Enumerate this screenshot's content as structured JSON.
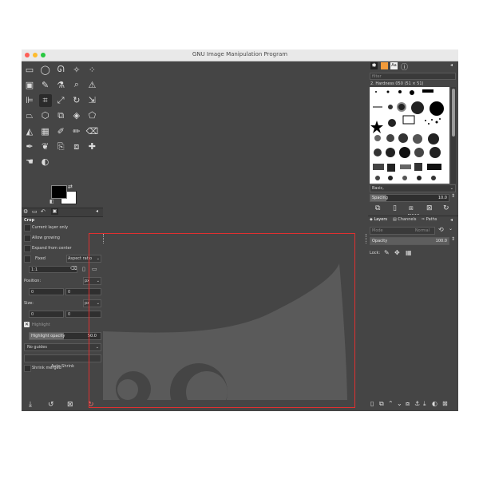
{
  "window": {
    "title": "GNU Image Manipulation Program",
    "colors": {
      "close": "#fe5f57",
      "minimize": "#febc2e",
      "zoom": "#28c840",
      "selection": "#e03030"
    }
  },
  "toolbox": {
    "tools": [
      {
        "name": "rect-select-icon",
        "glyph": "▭"
      },
      {
        "name": "ellipse-select-icon",
        "glyph": "◯"
      },
      {
        "name": "free-select-icon",
        "glyph": "ᘏ"
      },
      {
        "name": "fuzzy-select-icon",
        "glyph": "✧"
      },
      {
        "name": "select-by-color-icon",
        "glyph": "⁘"
      },
      {
        "name": "scissors-select-icon",
        "glyph": "✂"
      },
      {
        "name": "foreground-select-icon",
        "glyph": "▣"
      },
      {
        "name": "paths-icon",
        "glyph": "✎"
      },
      {
        "name": "color-picker-icon",
        "glyph": "⚗"
      },
      {
        "name": "zoom-icon",
        "glyph": "⌕"
      },
      {
        "name": "measure-icon",
        "glyph": "⚠"
      },
      {
        "name": "move-icon",
        "glyph": "✥"
      },
      {
        "name": "align-icon",
        "glyph": "⊫"
      },
      {
        "name": "crop-icon",
        "glyph": "⌗"
      },
      {
        "name": "unified-transform-icon",
        "glyph": "⤢"
      },
      {
        "name": "rotate-icon",
        "glyph": "↻"
      },
      {
        "name": "scale-icon",
        "glyph": "⇲"
      },
      {
        "name": "shear-icon",
        "glyph": "⧄"
      },
      {
        "name": "perspective-icon",
        "glyph": "⏢"
      },
      {
        "name": "3d-transform-icon",
        "glyph": "⬡"
      },
      {
        "name": "warp-transform-icon",
        "glyph": "⧉"
      },
      {
        "name": "handle-transform-icon",
        "glyph": "◈"
      },
      {
        "name": "cage-transform-icon",
        "glyph": "⬠"
      },
      {
        "name": "text-icon",
        "glyph": "A"
      },
      {
        "name": "bucket-fill-icon",
        "glyph": "◭"
      },
      {
        "name": "gradient-icon",
        "glyph": "▦"
      },
      {
        "name": "paintbrush-icon",
        "glyph": "✐"
      },
      {
        "name": "pencil-icon",
        "glyph": "✏"
      },
      {
        "name": "eraser-icon",
        "glyph": "⌫"
      },
      {
        "name": "airbrush-icon",
        "glyph": "✑"
      },
      {
        "name": "ink-icon",
        "glyph": "✒"
      },
      {
        "name": "mypaint-brush-icon",
        "glyph": "❦"
      },
      {
        "name": "clone-icon",
        "glyph": "⎘"
      },
      {
        "name": "perspective-clone-icon",
        "glyph": "⧈"
      },
      {
        "name": "heal-icon",
        "glyph": "✚"
      },
      {
        "name": "blur-sharpen-icon",
        "glyph": "⬮"
      },
      {
        "name": "smudge-icon",
        "glyph": "☚"
      },
      {
        "name": "dodge-burn-icon",
        "glyph": "◐"
      }
    ]
  },
  "tool_options": {
    "title": "Crop",
    "current_layer_only": "Current layer only",
    "allow_growing": "Allow growing",
    "expand_from_center": "Expand from center",
    "fixed": "Fixed",
    "aspect_ratio": "Aspect ratio",
    "ratio_value": "1:1",
    "position_label": "Position:",
    "position_unit": "px",
    "position_x": "0",
    "position_y": "0",
    "size_label": "Size:",
    "size_unit": "px",
    "size_w": "0",
    "size_h": "0",
    "highlight": "Highlight",
    "highlight_opacity": "Highlight opacity",
    "highlight_opacity_value": "50.0",
    "guides": "No guides",
    "auto_shrink": "Auto Shrink",
    "shrink_merged": "Shrink merged"
  },
  "brushes": {
    "filter_placeholder": "filter",
    "current_brush": "2. Hardness 050 (51 × 51)",
    "preset": "Basic,",
    "spacing_label": "Spacing",
    "spacing_value": "10.0"
  },
  "layers": {
    "tabs": [
      "Layers",
      "Channels",
      "Paths"
    ],
    "mode_label": "Mode",
    "mode_value": "Normal",
    "opacity_label": "Opacity",
    "opacity_value": "100.0",
    "lock_label": "Lock:"
  }
}
